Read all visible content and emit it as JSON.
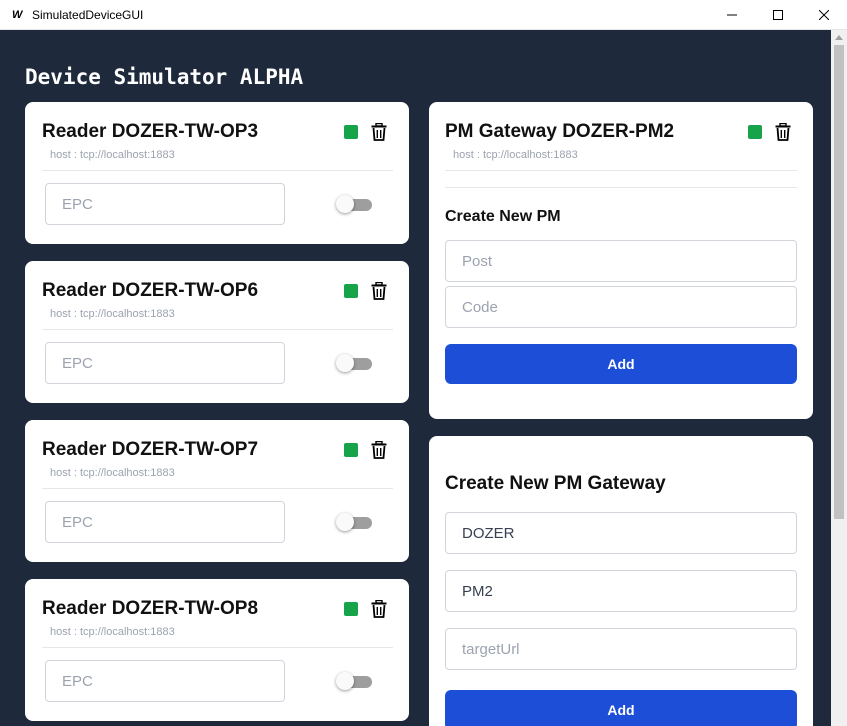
{
  "window": {
    "title": "SimulatedDeviceGUI",
    "icon": "W"
  },
  "app": {
    "title": "Device Simulator ALPHA"
  },
  "readers": [
    {
      "name": "Reader DOZER-TW-OP3",
      "host": "host : tcp://localhost:1883",
      "epc_placeholder": "EPC",
      "epc_value": "",
      "enabled": false,
      "status_color": "#16a34a"
    },
    {
      "name": "Reader DOZER-TW-OP6",
      "host": "host : tcp://localhost:1883",
      "epc_placeholder": "EPC",
      "epc_value": "",
      "enabled": false,
      "status_color": "#16a34a"
    },
    {
      "name": "Reader DOZER-TW-OP7",
      "host": "host : tcp://localhost:1883",
      "epc_placeholder": "EPC",
      "epc_value": "",
      "enabled": false,
      "status_color": "#16a34a"
    },
    {
      "name": "Reader DOZER-TW-OP8",
      "host": "host : tcp://localhost:1883",
      "epc_placeholder": "EPC",
      "epc_value": "",
      "enabled": false,
      "status_color": "#16a34a"
    }
  ],
  "pm_gateway": {
    "name": "PM Gateway DOZER-PM2",
    "host": "host : tcp://localhost:1883",
    "status_color": "#16a34a",
    "create_pm_title": "Create New PM",
    "post_placeholder": "Post",
    "code_placeholder": "Code",
    "add_label": "Add"
  },
  "create_gateway": {
    "title": "Create New PM Gateway",
    "field1_value": "DOZER",
    "field2_value": "PM2",
    "target_placeholder": "targetUrl",
    "add_label": "Add"
  },
  "colors": {
    "background": "#1e293b",
    "accent": "#1d4ed8",
    "status": "#16a34a"
  },
  "icons": [
    "trash-icon",
    "minimize-icon",
    "maximize-icon",
    "close-icon"
  ]
}
